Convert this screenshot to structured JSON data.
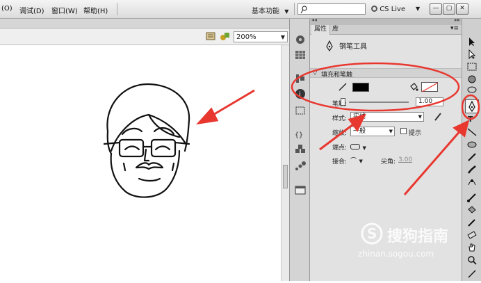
{
  "menubar": {
    "items": [
      "(O)",
      "调试(D)",
      "窗口(W)",
      "帮助(H)"
    ],
    "workspace": "基本功能",
    "search_placeholder": "",
    "cs_live": "CS Live"
  },
  "editbar": {
    "zoom": "200%"
  },
  "panel": {
    "tabs": [
      "属性",
      "库"
    ],
    "tool_name": "钢笔工具",
    "section_fill_stroke": "填充和笔触",
    "stroke_label": "笔触:",
    "stroke_value": "1.00",
    "style_label": "样式:",
    "style_value": "实线",
    "scale_label": "缩放:",
    "scale_value": "一般",
    "hint_label": "提示",
    "cap_label": "端点:",
    "join_label": "接合:",
    "miter_label": "尖角:",
    "miter_value": "3.00"
  },
  "colors": {
    "stroke_swatch": "#000000",
    "annotation": "#e8372f"
  },
  "watermark": {
    "title": "搜狗指南",
    "url": "zhinan.sogou.com"
  }
}
